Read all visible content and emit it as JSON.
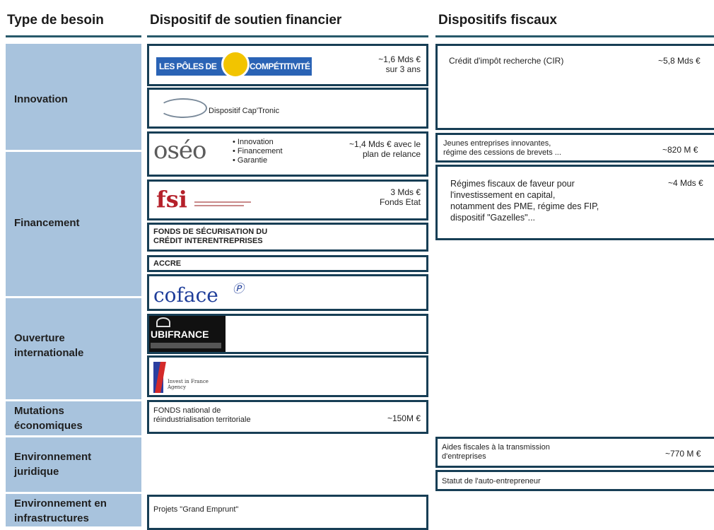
{
  "headers": {
    "type_besoin": "Type de besoin",
    "dispositif": "Dispositif de soutien financier",
    "fiscaux": "Dispositifs fiscaux"
  },
  "categories": [
    "Innovation",
    "Financement",
    "Ouverture internationale",
    "Mutations économiques",
    "Environnement juridique",
    "Environnement en infrastructures"
  ],
  "financial": {
    "poles": {
      "logo_left": "LES PÔLES DE",
      "logo_right": "COMPÉTITIVITÉ",
      "amount_line1": "~1,6 Mds €",
      "amount_line2": "sur 3 ans"
    },
    "captronic": {
      "label": "Dispositif Cap'Tronic"
    },
    "oseo": {
      "logo": "oséo",
      "items": [
        "Innovation",
        "Financement",
        "Garantie"
      ],
      "amount_line1": "~1,4 Mds € avec le",
      "amount_line2": "plan de relance"
    },
    "fsi": {
      "logo": "fsi",
      "amount_line1": "3 Mds €",
      "amount_line2": "Fonds Etat"
    },
    "fonds_securisation": {
      "line1": "FONDS DE SÉCURISATION DU",
      "line2": "CRÉDIT INTERENTREPRISES"
    },
    "accre": {
      "label": "ACCRE"
    },
    "coface": {
      "logo": "coface"
    },
    "ubifrance": {
      "logo": "UBIFRANCE"
    },
    "invest": {
      "logo_line1": "Invest in France",
      "logo_line2": "Agency"
    },
    "fonds_national": {
      "line1": "FONDS national de",
      "line2": "réindustrialisation territoriale",
      "amount": "~150M €"
    },
    "grand_emprunt": {
      "label": "Projets \"Grand Emprunt\""
    }
  },
  "fiscal": {
    "cir": {
      "label": "Crédit d'impôt recherche (CIR)",
      "amount": "~5,8 Mds €"
    },
    "jei": {
      "line1": "Jeunes entreprises innovantes,",
      "line2": "régime des cessions de brevets ...",
      "amount": "~820 M €"
    },
    "regimes": {
      "line1": "Régimes fiscaux de faveur pour",
      "line2": "l'investissement en capital,",
      "line3": "notamment des PME, régime des FIP,",
      "line4": "dispositif \"Gazelles\"...",
      "amount": "~4 Mds €"
    },
    "aides": {
      "line1": "Aides fiscales à la transmission",
      "line2": "d'entreprises",
      "amount": "~770 M €"
    },
    "auto": {
      "label": "Statut de l'auto-entrepreneur"
    }
  },
  "colors": {
    "category_bg": "#a8c3dd",
    "box_border": "#173e55",
    "header_line": "#27596a"
  }
}
